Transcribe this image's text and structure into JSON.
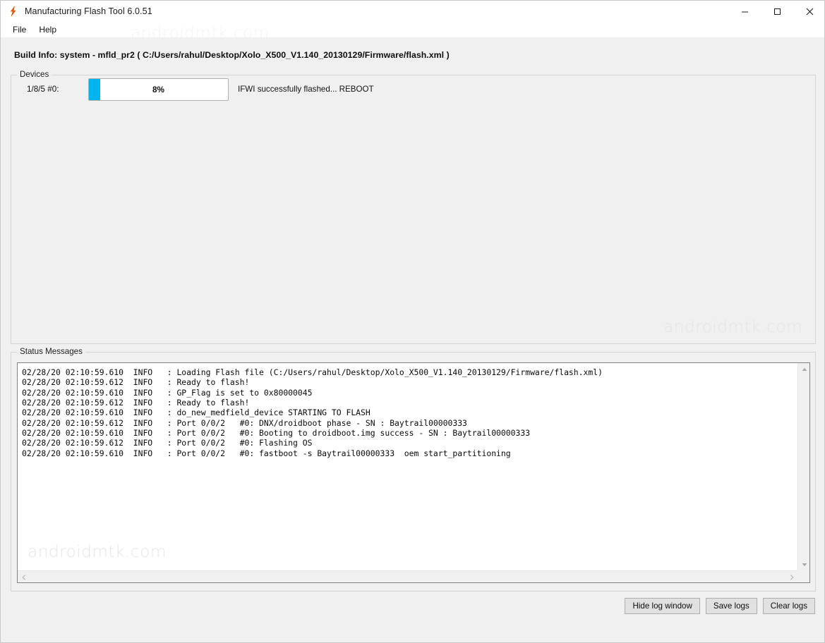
{
  "window": {
    "title": "Manufacturing Flash Tool 6.0.51",
    "icon": "lightning-bolt-icon",
    "controls": {
      "minimize": "minimize-icon",
      "maximize": "maximize-icon",
      "close": "close-icon"
    }
  },
  "menu": {
    "items": [
      {
        "label": "File"
      },
      {
        "label": "Help"
      }
    ]
  },
  "build_info": {
    "label": "Build Info:",
    "text": "Build Info:  system - mfld_pr2 ( C:/Users/rahul/Desktop/Xolo_X500_V1.140_20130129/Firmware/flash.xml )"
  },
  "devices": {
    "legend": "Devices",
    "rows": [
      {
        "id_label": "1/8/5  #0:",
        "progress_percent": 8,
        "progress_text": "8%",
        "progress_color": "#00b5f0",
        "status": "IFWI successfully flashed... REBOOT"
      }
    ]
  },
  "status_messages": {
    "legend": "Status Messages",
    "lines": [
      "02/28/20 02:10:59.610  INFO   : Loading Flash file (C:/Users/rahul/Desktop/Xolo_X500_V1.140_20130129/Firmware/flash.xml)",
      "02/28/20 02:10:59.612  INFO   : Ready to flash!",
      "02/28/20 02:10:59.610  INFO   : GP_Flag is set to 0x80000045",
      "02/28/20 02:10:59.612  INFO   : Ready to flash!",
      "02/28/20 02:10:59.610  INFO   : do_new_medfield_device STARTING TO FLASH",
      "02/28/20 02:10:59.612  INFO   : Port 0/0/2   #0: DNX/droidboot phase - SN : Baytrail00000333",
      "02/28/20 02:10:59.610  INFO   : Port 0/0/2   #0: Booting to droidboot.img success - SN : Baytrail00000333",
      "02/28/20 02:10:59.612  INFO   : Port 0/0/2   #0: Flashing OS",
      "02/28/20 02:10:59.610  INFO   : Port 0/0/2   #0: fastboot -s Baytrail00000333  oem start_partitioning"
    ]
  },
  "buttons": {
    "hide_log": "Hide log window",
    "save_logs": "Save logs",
    "clear_logs": "Clear logs"
  },
  "watermarks": {
    "top": "androidmtk.com",
    "devices": "androidmtk.com",
    "log": "androidmtk.com"
  }
}
